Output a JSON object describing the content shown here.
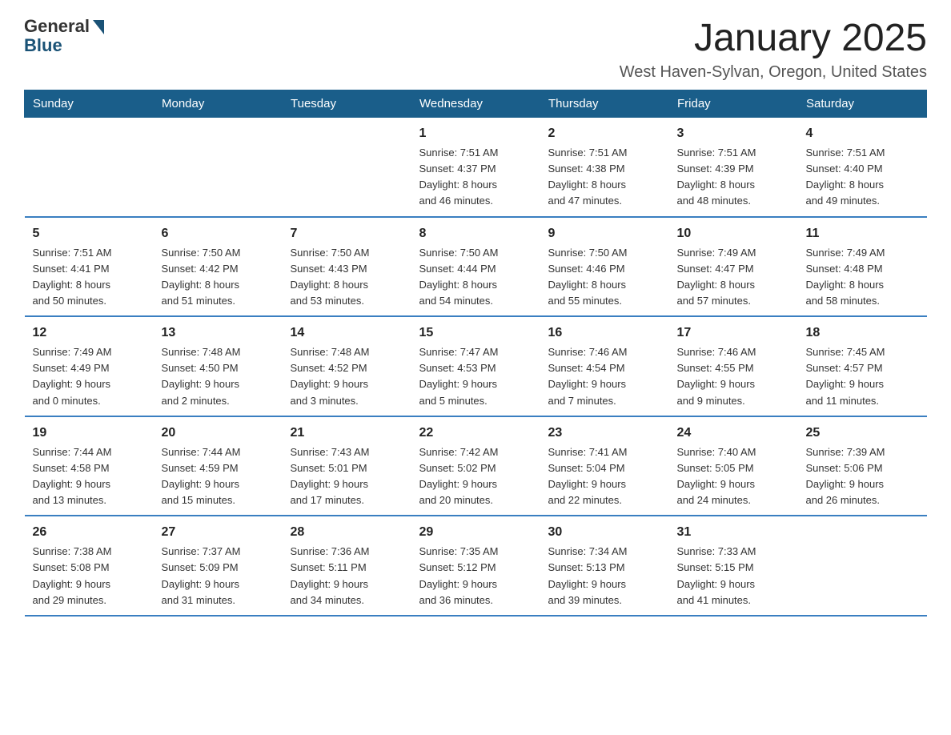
{
  "logo": {
    "general": "General",
    "blue": "Blue"
  },
  "header": {
    "month_title": "January 2025",
    "location": "West Haven-Sylvan, Oregon, United States"
  },
  "days_of_week": [
    "Sunday",
    "Monday",
    "Tuesday",
    "Wednesday",
    "Thursday",
    "Friday",
    "Saturday"
  ],
  "weeks": [
    [
      {
        "day": "",
        "info": ""
      },
      {
        "day": "",
        "info": ""
      },
      {
        "day": "",
        "info": ""
      },
      {
        "day": "1",
        "info": "Sunrise: 7:51 AM\nSunset: 4:37 PM\nDaylight: 8 hours\nand 46 minutes."
      },
      {
        "day": "2",
        "info": "Sunrise: 7:51 AM\nSunset: 4:38 PM\nDaylight: 8 hours\nand 47 minutes."
      },
      {
        "day": "3",
        "info": "Sunrise: 7:51 AM\nSunset: 4:39 PM\nDaylight: 8 hours\nand 48 minutes."
      },
      {
        "day": "4",
        "info": "Sunrise: 7:51 AM\nSunset: 4:40 PM\nDaylight: 8 hours\nand 49 minutes."
      }
    ],
    [
      {
        "day": "5",
        "info": "Sunrise: 7:51 AM\nSunset: 4:41 PM\nDaylight: 8 hours\nand 50 minutes."
      },
      {
        "day": "6",
        "info": "Sunrise: 7:50 AM\nSunset: 4:42 PM\nDaylight: 8 hours\nand 51 minutes."
      },
      {
        "day": "7",
        "info": "Sunrise: 7:50 AM\nSunset: 4:43 PM\nDaylight: 8 hours\nand 53 minutes."
      },
      {
        "day": "8",
        "info": "Sunrise: 7:50 AM\nSunset: 4:44 PM\nDaylight: 8 hours\nand 54 minutes."
      },
      {
        "day": "9",
        "info": "Sunrise: 7:50 AM\nSunset: 4:46 PM\nDaylight: 8 hours\nand 55 minutes."
      },
      {
        "day": "10",
        "info": "Sunrise: 7:49 AM\nSunset: 4:47 PM\nDaylight: 8 hours\nand 57 minutes."
      },
      {
        "day": "11",
        "info": "Sunrise: 7:49 AM\nSunset: 4:48 PM\nDaylight: 8 hours\nand 58 minutes."
      }
    ],
    [
      {
        "day": "12",
        "info": "Sunrise: 7:49 AM\nSunset: 4:49 PM\nDaylight: 9 hours\nand 0 minutes."
      },
      {
        "day": "13",
        "info": "Sunrise: 7:48 AM\nSunset: 4:50 PM\nDaylight: 9 hours\nand 2 minutes."
      },
      {
        "day": "14",
        "info": "Sunrise: 7:48 AM\nSunset: 4:52 PM\nDaylight: 9 hours\nand 3 minutes."
      },
      {
        "day": "15",
        "info": "Sunrise: 7:47 AM\nSunset: 4:53 PM\nDaylight: 9 hours\nand 5 minutes."
      },
      {
        "day": "16",
        "info": "Sunrise: 7:46 AM\nSunset: 4:54 PM\nDaylight: 9 hours\nand 7 minutes."
      },
      {
        "day": "17",
        "info": "Sunrise: 7:46 AM\nSunset: 4:55 PM\nDaylight: 9 hours\nand 9 minutes."
      },
      {
        "day": "18",
        "info": "Sunrise: 7:45 AM\nSunset: 4:57 PM\nDaylight: 9 hours\nand 11 minutes."
      }
    ],
    [
      {
        "day": "19",
        "info": "Sunrise: 7:44 AM\nSunset: 4:58 PM\nDaylight: 9 hours\nand 13 minutes."
      },
      {
        "day": "20",
        "info": "Sunrise: 7:44 AM\nSunset: 4:59 PM\nDaylight: 9 hours\nand 15 minutes."
      },
      {
        "day": "21",
        "info": "Sunrise: 7:43 AM\nSunset: 5:01 PM\nDaylight: 9 hours\nand 17 minutes."
      },
      {
        "day": "22",
        "info": "Sunrise: 7:42 AM\nSunset: 5:02 PM\nDaylight: 9 hours\nand 20 minutes."
      },
      {
        "day": "23",
        "info": "Sunrise: 7:41 AM\nSunset: 5:04 PM\nDaylight: 9 hours\nand 22 minutes."
      },
      {
        "day": "24",
        "info": "Sunrise: 7:40 AM\nSunset: 5:05 PM\nDaylight: 9 hours\nand 24 minutes."
      },
      {
        "day": "25",
        "info": "Sunrise: 7:39 AM\nSunset: 5:06 PM\nDaylight: 9 hours\nand 26 minutes."
      }
    ],
    [
      {
        "day": "26",
        "info": "Sunrise: 7:38 AM\nSunset: 5:08 PM\nDaylight: 9 hours\nand 29 minutes."
      },
      {
        "day": "27",
        "info": "Sunrise: 7:37 AM\nSunset: 5:09 PM\nDaylight: 9 hours\nand 31 minutes."
      },
      {
        "day": "28",
        "info": "Sunrise: 7:36 AM\nSunset: 5:11 PM\nDaylight: 9 hours\nand 34 minutes."
      },
      {
        "day": "29",
        "info": "Sunrise: 7:35 AM\nSunset: 5:12 PM\nDaylight: 9 hours\nand 36 minutes."
      },
      {
        "day": "30",
        "info": "Sunrise: 7:34 AM\nSunset: 5:13 PM\nDaylight: 9 hours\nand 39 minutes."
      },
      {
        "day": "31",
        "info": "Sunrise: 7:33 AM\nSunset: 5:15 PM\nDaylight: 9 hours\nand 41 minutes."
      },
      {
        "day": "",
        "info": ""
      }
    ]
  ]
}
